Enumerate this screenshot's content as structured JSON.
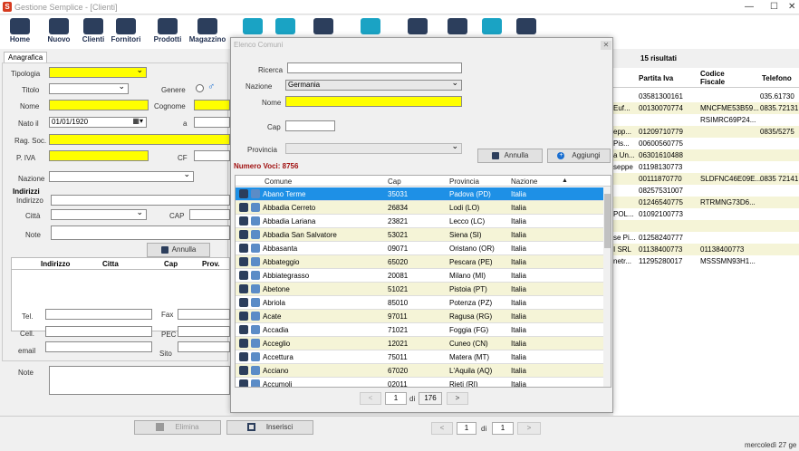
{
  "app": {
    "title": "Gestione Semplice - [Clienti]",
    "date": "mercoledì 27 ge"
  },
  "toolbar": [
    {
      "label": "Home",
      "icon": "home-icon"
    },
    {
      "label": "Nuovo",
      "icon": "new-icon"
    },
    {
      "label": "Clienti",
      "icon": "clients-icon"
    },
    {
      "label": "Fornitori",
      "icon": "suppliers-icon"
    },
    {
      "label": "Prodotti",
      "icon": "products-icon"
    },
    {
      "label": "Magazzino",
      "icon": "warehouse-icon"
    },
    {
      "label": "",
      "icon": "cart-icon"
    },
    {
      "label": "",
      "icon": "truck-icon"
    },
    {
      "label": "",
      "icon": "phone-icon"
    },
    {
      "label": "",
      "icon": "money-icon"
    },
    {
      "label": "",
      "icon": "tools-icon"
    },
    {
      "label": "",
      "icon": "inbox-icon"
    },
    {
      "label": "",
      "icon": "support-icon"
    },
    {
      "label": "",
      "icon": "cloud-icon"
    }
  ],
  "form": {
    "tab": "Anagrafica",
    "tipologia": "Tipologia",
    "titolo": "Titolo",
    "genere": "Genere",
    "nome": "Nome",
    "cognome": "Cognome",
    "nato_il": "Nato il",
    "nato_val": "01/01/1920",
    "a": "a",
    "rag_soc": "Rag. Soc.",
    "piva": "P. IVA",
    "cf": "CF",
    "nazione": "Nazione",
    "indirizzi": "Indirizzi",
    "indirizzo": "Indirizzo",
    "citta": "Città",
    "cap": "CAP",
    "note": "Note",
    "annulla": "Annulla",
    "addr_cols": [
      "Indirizzo",
      "Citta",
      "Cap",
      "Prov."
    ],
    "tel": "Tel.",
    "fax": "Fax",
    "cell": "Cell.",
    "pec": "PEC",
    "email": "email",
    "sito": "Sito",
    "note2": "Note",
    "elimina": "Elimina",
    "inserisci": "Inserisci"
  },
  "right": {
    "results": "15 risultati",
    "cols": [
      "Partita Iva",
      "Codice Fiscale",
      "Telefono"
    ],
    "rows": [
      {
        "a": "",
        "piva": "03581300161",
        "cf": "",
        "tel": "035.61730"
      },
      {
        "a": "Euf...",
        "piva": "00130070774",
        "cf": "MNCFME53B59...",
        "tel": "0835.72131"
      },
      {
        "a": "",
        "piva": "",
        "cf": "RSIMRC69P24...",
        "tel": ""
      },
      {
        "a": "epp...",
        "piva": "01209710779",
        "cf": "",
        "tel": "0835/5275"
      },
      {
        "a": "Pis...",
        "piva": "00600560775",
        "cf": "",
        "tel": ""
      },
      {
        "a": "a Un...",
        "piva": "06301610488",
        "cf": "",
        "tel": ""
      },
      {
        "a": "seppe",
        "piva": "01198130773",
        "cf": "",
        "tel": ""
      },
      {
        "a": "",
        "piva": "00111870770",
        "cf": "SLDFNC46E09E...",
        "tel": "0835 72141"
      },
      {
        "a": "",
        "piva": "08257531007",
        "cf": "",
        "tel": ""
      },
      {
        "a": "",
        "piva": "01246540775",
        "cf": "RTRMNG73D6...",
        "tel": ""
      },
      {
        "a": "POL...",
        "piva": "01092100773",
        "cf": "",
        "tel": ""
      },
      {
        "a": "",
        "piva": "",
        "cf": "",
        "tel": ""
      },
      {
        "a": "se Pi...",
        "piva": "01258240777",
        "cf": "",
        "tel": ""
      },
      {
        "a": "I SRL",
        "piva": "01138400773",
        "cf": "01138400773",
        "tel": ""
      },
      {
        "a": "netr...",
        "piva": "11295280017",
        "cf": "MSSSMN93H1...",
        "tel": ""
      }
    ],
    "page": "1",
    "of": "di",
    "total": "1"
  },
  "dialog": {
    "title": "Elenco Comuni",
    "ricerca": "Ricerca",
    "nazione": "Nazione",
    "nazione_val": "Germania",
    "nome": "Nome",
    "cap": "Cap",
    "provincia": "Provincia",
    "annulla": "Annulla",
    "aggiungi": "Aggiungi",
    "numero_label": "Numero Voci:",
    "numero_val": "8756",
    "cols": [
      "Comune",
      "Cap",
      "Provincia",
      "Nazione"
    ],
    "rows": [
      {
        "c": "Abano Terme",
        "cap": "35031",
        "p": "Padova (PD)",
        "n": "Italia"
      },
      {
        "c": "Abbadia Cerreto",
        "cap": "26834",
        "p": "Lodi (LO)",
        "n": "Italia"
      },
      {
        "c": "Abbadia Lariana",
        "cap": "23821",
        "p": "Lecco (LC)",
        "n": "Italia"
      },
      {
        "c": "Abbadia San Salvatore",
        "cap": "53021",
        "p": "Siena (SI)",
        "n": "Italia"
      },
      {
        "c": "Abbasanta",
        "cap": "09071",
        "p": "Oristano (OR)",
        "n": "Italia"
      },
      {
        "c": "Abbateggio",
        "cap": "65020",
        "p": "Pescara (PE)",
        "n": "Italia"
      },
      {
        "c": "Abbiategrasso",
        "cap": "20081",
        "p": "Milano (MI)",
        "n": "Italia"
      },
      {
        "c": "Abetone",
        "cap": "51021",
        "p": "Pistoia (PT)",
        "n": "Italia"
      },
      {
        "c": "Abriola",
        "cap": "85010",
        "p": "Potenza (PZ)",
        "n": "Italia"
      },
      {
        "c": "Acate",
        "cap": "97011",
        "p": "Ragusa (RG)",
        "n": "Italia"
      },
      {
        "c": "Accadia",
        "cap": "71021",
        "p": "Foggia (FG)",
        "n": "Italia"
      },
      {
        "c": "Acceglio",
        "cap": "12021",
        "p": "Cuneo (CN)",
        "n": "Italia"
      },
      {
        "c": "Accettura",
        "cap": "75011",
        "p": "Matera (MT)",
        "n": "Italia"
      },
      {
        "c": "Acciano",
        "cap": "67020",
        "p": "L'Aquila (AQ)",
        "n": "Italia"
      },
      {
        "c": "Accumoli",
        "cap": "02011",
        "p": "Rieti (RI)",
        "n": "Italia"
      }
    ],
    "page": "1",
    "of": "di",
    "total": "176"
  }
}
